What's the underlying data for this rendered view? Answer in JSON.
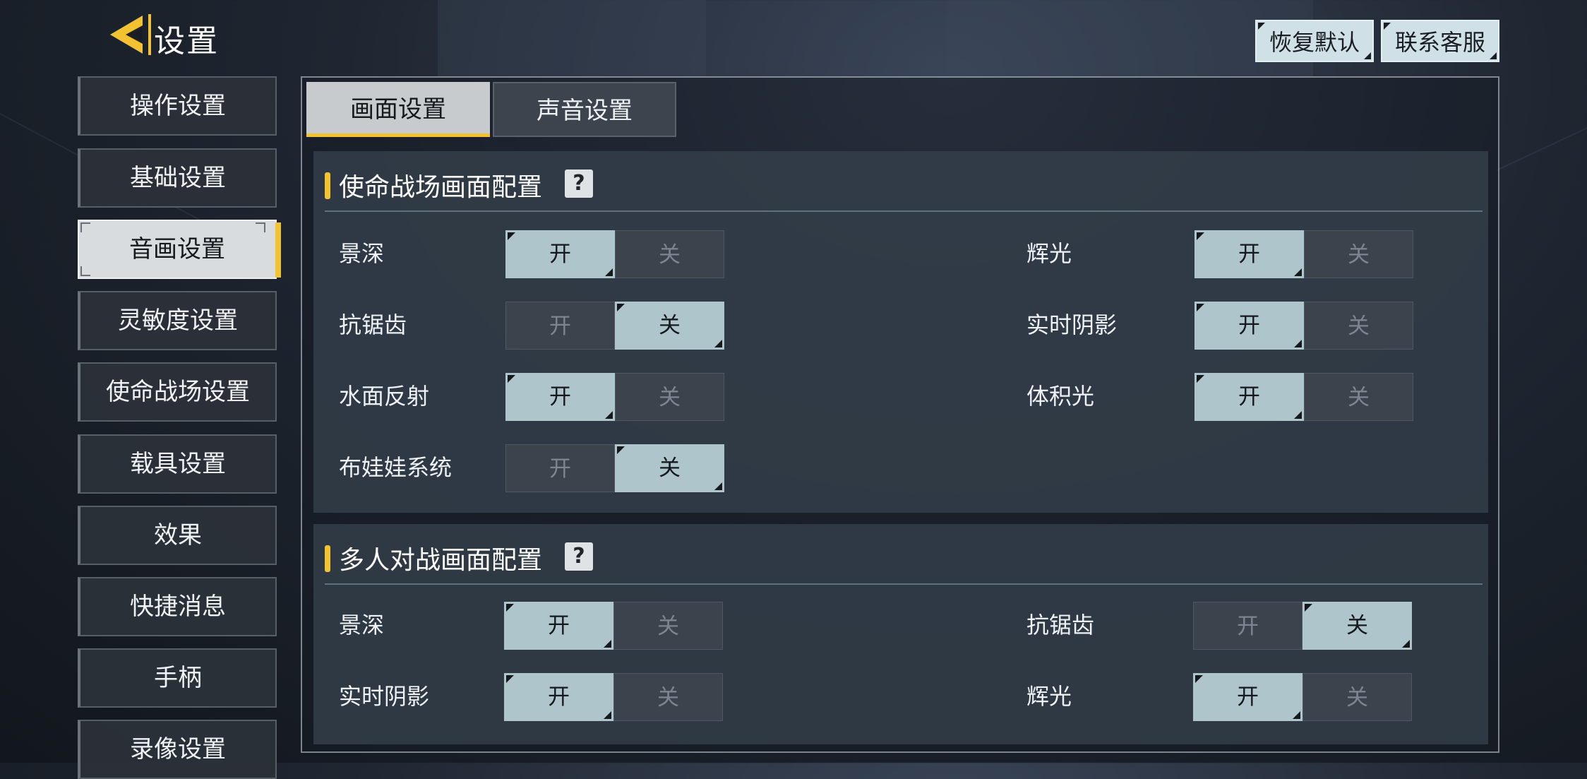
{
  "header": {
    "title": "设置",
    "restore_default": "恢复默认",
    "contact_support": "联系客服"
  },
  "sidebar": {
    "items": [
      {
        "label": "操作设置"
      },
      {
        "label": "基础设置"
      },
      {
        "label": "音画设置"
      },
      {
        "label": "灵敏度设置"
      },
      {
        "label": "使命战场设置"
      },
      {
        "label": "载具设置"
      },
      {
        "label": "效果"
      },
      {
        "label": "快捷消息"
      },
      {
        "label": "手柄"
      },
      {
        "label": "录像设置"
      }
    ],
    "active": "音画设置"
  },
  "tabs": [
    {
      "label": "画面设置",
      "active": true
    },
    {
      "label": "声音设置",
      "active": false
    }
  ],
  "sections": [
    {
      "title": "使命战场画面配置",
      "help": "?",
      "settings": [
        {
          "label": "景深",
          "on": "开",
          "off": "关",
          "value": "开"
        },
        {
          "label": "辉光",
          "on": "开",
          "off": "关",
          "value": "开"
        },
        {
          "label": "抗锯齿",
          "on": "开",
          "off": "关",
          "value": "关"
        },
        {
          "label": "实时阴影",
          "on": "开",
          "off": "关",
          "value": "开"
        },
        {
          "label": "水面反射",
          "on": "开",
          "off": "关",
          "value": "开"
        },
        {
          "label": "体积光",
          "on": "开",
          "off": "关",
          "value": "开"
        },
        {
          "label": "布娃娃系统",
          "on": "开",
          "off": "关",
          "value": "关"
        }
      ]
    },
    {
      "title": "多人对战画面配置",
      "help": "?",
      "settings": [
        {
          "label": "景深",
          "on": "开",
          "off": "关",
          "value": "开"
        },
        {
          "label": "抗锯齿",
          "on": "开",
          "off": "关",
          "value": "关"
        },
        {
          "label": "实时阴影",
          "on": "开",
          "off": "关",
          "value": "开"
        },
        {
          "label": "辉光",
          "on": "开",
          "off": "关",
          "value": "开"
        }
      ]
    }
  ],
  "colors": {
    "accent_yellow": "#f2c230",
    "toggle_selected": "#aec5cb",
    "toggle_unselected": "#3b434d"
  }
}
